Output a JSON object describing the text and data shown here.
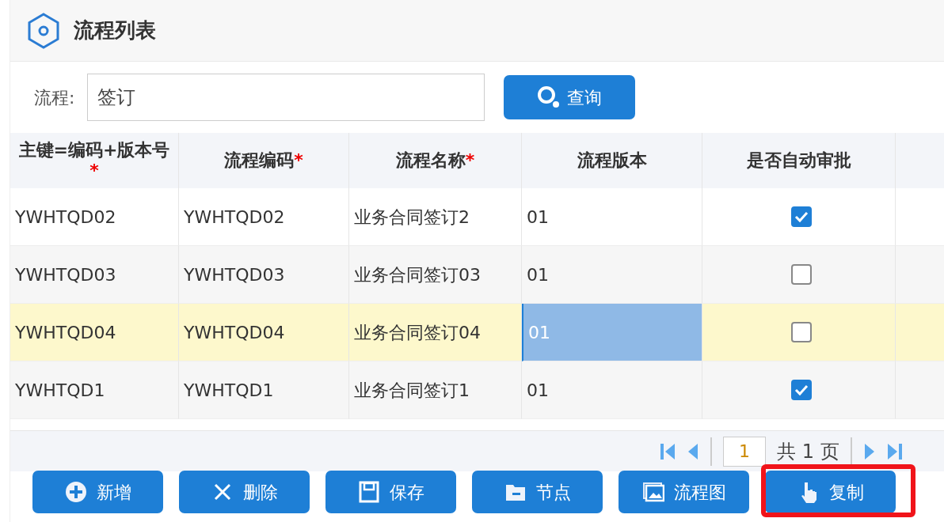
{
  "title": "流程列表",
  "search": {
    "label": "流程:",
    "value": "签订",
    "button": "查询"
  },
  "table": {
    "columns": [
      {
        "label": "主键=编码+版本号",
        "mark": "*"
      },
      {
        "label": "流程编码",
        "mark": "*"
      },
      {
        "label": "流程名称",
        "mark": "*"
      },
      {
        "label": "流程版本"
      },
      {
        "label": "是否自动审批"
      }
    ],
    "rows": [
      {
        "key": "YWHTQD02",
        "code": "YWHTQD02",
        "name": "业务合同签订2",
        "version": "01",
        "auto_approve": true,
        "selected": false,
        "editing": false
      },
      {
        "key": "YWHTQD03",
        "code": "YWHTQD03",
        "name": "业务合同签订03",
        "version": "01",
        "auto_approve": false,
        "selected": false,
        "editing": false
      },
      {
        "key": "YWHTQD04",
        "code": "YWHTQD04",
        "name": "业务合同签订04",
        "version": "01",
        "auto_approve": false,
        "selected": true,
        "editing": true
      },
      {
        "key": "YWHTQD1",
        "code": "YWHTQD1",
        "name": "业务合同签订1",
        "version": "01",
        "auto_approve": true,
        "selected": false,
        "editing": false
      }
    ]
  },
  "pager": {
    "page": "1",
    "total": "共 1 页"
  },
  "buttons": [
    {
      "kind": "add",
      "label": "新增",
      "highlighted": false
    },
    {
      "kind": "delete",
      "label": "删除",
      "highlighted": false
    },
    {
      "kind": "save",
      "label": "保存",
      "highlighted": false
    },
    {
      "kind": "node",
      "label": "节点",
      "highlighted": false
    },
    {
      "kind": "diagram",
      "label": "流程图",
      "highlighted": false
    },
    {
      "kind": "copy",
      "label": "复制",
      "highlighted": true
    }
  ]
}
